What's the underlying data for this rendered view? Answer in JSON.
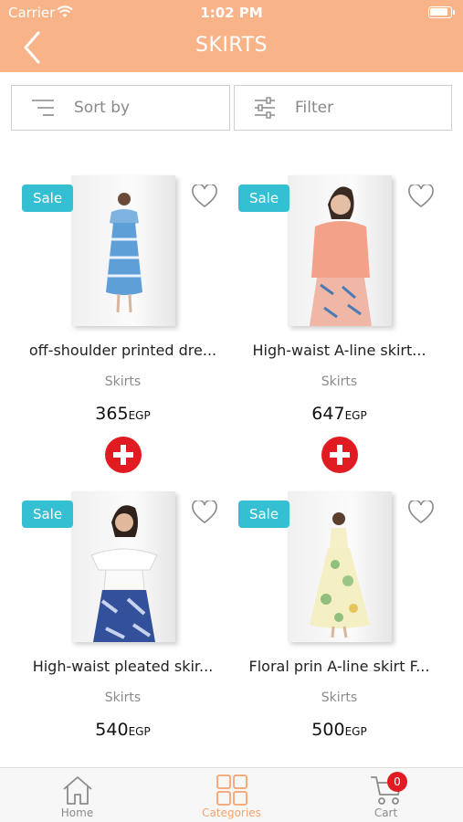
{
  "status_bar": {
    "carrier": "Carrier",
    "time": "1:02 PM"
  },
  "header": {
    "title": "SKIRTS"
  },
  "toolbar": {
    "sort_label": "Sort by",
    "filter_label": "Filter"
  },
  "products": [
    {
      "badge": "Sale",
      "name": "off-shoulder printed dre...",
      "category": "Skirts",
      "price": "365",
      "currency": "EGP"
    },
    {
      "badge": "Sale",
      "name": "High-waist A-line skirt...",
      "category": "Skirts",
      "price": "647",
      "currency": "EGP"
    },
    {
      "badge": "Sale",
      "name": "High-waist pleated skir...",
      "category": "Skirts",
      "price": "540",
      "currency": "EGP"
    },
    {
      "badge": "Sale",
      "name": "Floral prin A-line skirt F...",
      "category": "Skirts",
      "price": "500",
      "currency": "EGP"
    }
  ],
  "tabbar": {
    "tabs": [
      {
        "label": "Home",
        "icon": "home-icon"
      },
      {
        "label": "Categories",
        "icon": "grid-icon"
      },
      {
        "label": "Cart",
        "icon": "cart-icon"
      }
    ],
    "active": "Categories",
    "cart_count": "0"
  },
  "colors": {
    "header": "#f8b389",
    "sale_badge": "#34bfd3",
    "add_button": "#e11b22",
    "active_tab": "#f5a36f"
  }
}
